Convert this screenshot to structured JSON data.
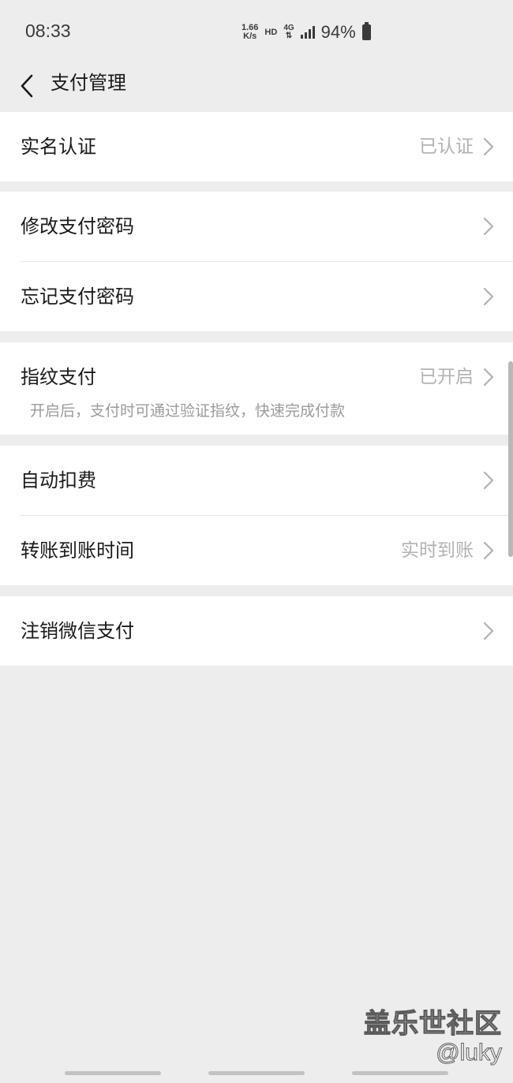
{
  "status_bar": {
    "time": "08:33",
    "net_speed_value": "1.66",
    "net_speed_unit": "K/s",
    "hd": "HD",
    "network": "4G",
    "battery": "94%"
  },
  "nav": {
    "title": "支付管理"
  },
  "groups": [
    {
      "rows": [
        {
          "label": "实名认证",
          "value": "已认证"
        }
      ]
    },
    {
      "rows": [
        {
          "label": "修改支付密码",
          "value": ""
        },
        {
          "label": "忘记支付密码",
          "value": ""
        }
      ]
    },
    {
      "rows": [
        {
          "label": "指纹支付",
          "value": "已开启",
          "description": "开启后，支付时可通过验证指纹，快速完成付款"
        }
      ]
    },
    {
      "rows": [
        {
          "label": "自动扣费",
          "value": ""
        },
        {
          "label": "转账到账时间",
          "value": "实时到账"
        }
      ]
    },
    {
      "rows": [
        {
          "label": "注销微信支付",
          "value": ""
        }
      ]
    }
  ],
  "watermark": {
    "title": "盖乐世社区",
    "handle": "@luky"
  },
  "colors": {
    "background": "#ededed",
    "card": "#ffffff",
    "secondary_text": "#b2b2b2",
    "chevron": "#b2b2b2"
  }
}
